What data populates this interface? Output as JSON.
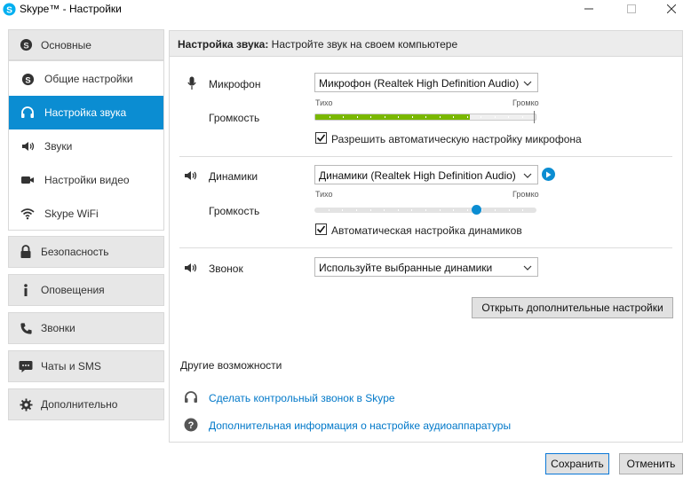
{
  "window": {
    "title": "Skype™ - Настройки",
    "app_icon": "skype-icon",
    "controls": [
      "minimize-icon",
      "maximize-icon",
      "close-icon"
    ]
  },
  "sidebar": {
    "groups_top": {
      "label": "Основные",
      "icon": "skype-icon"
    },
    "sub_items": [
      {
        "label": "Общие настройки",
        "icon": "skype-icon",
        "active": false
      },
      {
        "label": "Настройка звука",
        "icon": "headset-icon",
        "active": true
      },
      {
        "label": "Звуки",
        "icon": "speaker-icon",
        "active": false
      },
      {
        "label": "Настройки видео",
        "icon": "video-camera-icon",
        "active": false
      },
      {
        "label": "Skype WiFi",
        "icon": "wifi-icon",
        "active": false
      }
    ],
    "groups": [
      {
        "label": "Безопасность",
        "icon": "lock-icon"
      },
      {
        "label": "Оповещения",
        "icon": "info-icon"
      },
      {
        "label": "Звонки",
        "icon": "phone-icon"
      },
      {
        "label": "Чаты и SMS",
        "icon": "chat-icon"
      },
      {
        "label": "Дополнительно",
        "icon": "gear-icon"
      }
    ]
  },
  "panel": {
    "header_bold": "Настройка звука:",
    "header_text": " Настройте звук на своем компьютере",
    "microphone": {
      "label": "Микрофон",
      "icon": "microphone-icon",
      "device": "Микрофон (Realtek High Definition Audio)",
      "volume_label": "Громкость",
      "low_label": "Тихо",
      "high_label": "Громко",
      "level": 0.7,
      "auto_checkbox_label": "Разрешить автоматическую настройку микрофона",
      "auto_checked": true
    },
    "speakers": {
      "label": "Динамики",
      "icon": "speaker-icon",
      "device": "Динамики (Realtek High Definition Audio)",
      "play_icon": "play-icon",
      "volume_label": "Громкость",
      "low_label": "Тихо",
      "high_label": "Громко",
      "level": 0.73,
      "auto_checkbox_label": "Автоматическая настройка динамиков",
      "auto_checked": true
    },
    "ringer": {
      "label": "Звонок",
      "icon": "speaker-icon",
      "device": "Используйте выбранные динамики"
    },
    "advanced_button": "Открыть дополнительные настройки",
    "other": {
      "title": "Другие возможности",
      "links": [
        {
          "label": "Сделать контрольный звонок в Skype",
          "icon": "headset-icon"
        },
        {
          "label": "Дополнительная информация о настройке аудиоаппаратуры",
          "icon": "help-icon"
        }
      ]
    }
  },
  "footer": {
    "save": "Сохранить",
    "cancel": "Отменить"
  },
  "colors": {
    "accent": "#0b8dd2",
    "level_fill": "#7ab800",
    "link": "#0078c9"
  }
}
